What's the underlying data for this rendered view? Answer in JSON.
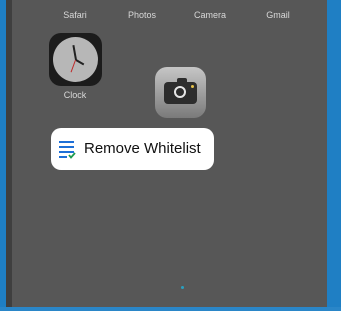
{
  "dock_labels": [
    "Safari",
    "Photos",
    "Camera",
    "Gmail"
  ],
  "apps": {
    "clock_label": "Clock"
  },
  "popover": {
    "label": "Remove Whitelist",
    "icon": "list-check-icon",
    "icon_color": "#1d6fd6",
    "check_color": "#1e9b4f"
  },
  "colors": {
    "frame": "#1f7fc4",
    "screen": "#575757",
    "page_dot": "#2aa0c0"
  }
}
